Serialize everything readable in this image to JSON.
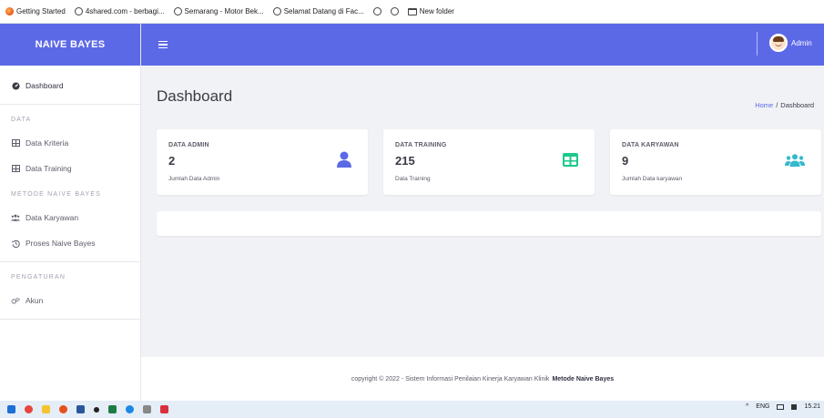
{
  "bookmarks": [
    {
      "label": "Getting Started",
      "icon": "firefox-icon"
    },
    {
      "label": "4shared.com - berbagi...",
      "icon": "globe-icon"
    },
    {
      "label": "Semarang - Motor Bek...",
      "icon": "globe-icon"
    },
    {
      "label": "Selamat Datang di Fac...",
      "icon": "globe-icon"
    },
    {
      "label": "",
      "icon": "globe-icon"
    },
    {
      "label": "",
      "icon": "globe-icon"
    },
    {
      "label": "New folder",
      "icon": "folder-icon"
    }
  ],
  "brand": "NAIVE BAYES",
  "user": {
    "name": "Admin"
  },
  "sidebar": {
    "dashboard": "Dashboard",
    "heading_data": "DATA",
    "data_kriteria": "Data Kriteria",
    "data_training": "Data Training",
    "heading_metode": "METODE NAIVE BAYES",
    "data_karyawan": "Data Karyawan",
    "proses": "Proses Naive Bayes",
    "heading_pengaturan": "PENGATURAN",
    "akun": "Akun"
  },
  "page": {
    "title": "Dashboard",
    "breadcrumb_home": "Home",
    "breadcrumb_sep": "/",
    "breadcrumb_current": "Dashboard"
  },
  "cards": [
    {
      "title": "DATA ADMIN",
      "value": "2",
      "sub": "Jumlah Data Admin",
      "icon": "user-icon",
      "color": "#5c69e6"
    },
    {
      "title": "DATA TRAINING",
      "value": "215",
      "sub": "Data Training",
      "icon": "table-icon",
      "color": "#1cc88a"
    },
    {
      "title": "DATA KARYAWAN",
      "value": "9",
      "sub": "Jumlah Data karyawan",
      "icon": "users-icon",
      "color": "#36b9cc"
    }
  ],
  "footer": {
    "text": "copyright © 2022 - Sistem Informasi Penilaian Kinerja Karyawan Klinik",
    "bold": "Metode Naive Bayes"
  },
  "taskbar": {
    "lang": "ENG",
    "time": "15.21"
  },
  "colors": {
    "primary": "#5c69e6",
    "success": "#1cc88a",
    "info": "#36b9cc"
  }
}
